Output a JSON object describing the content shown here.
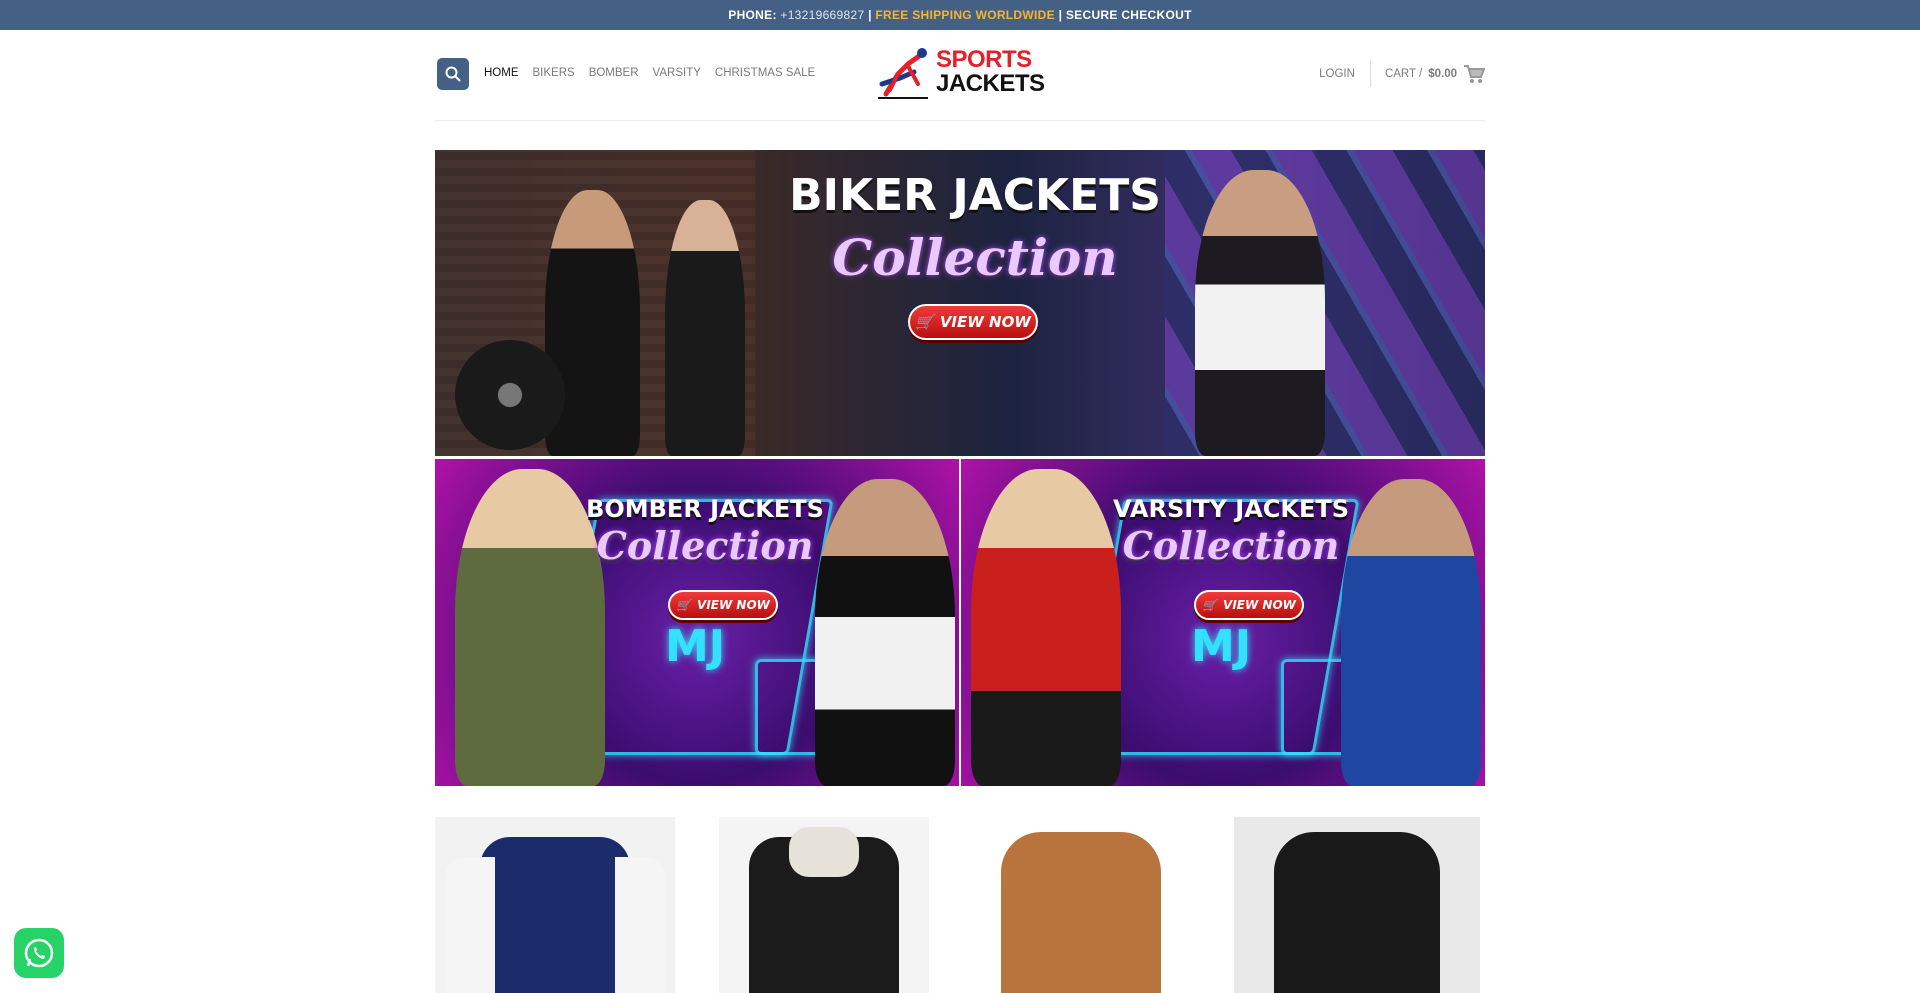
{
  "topbar": {
    "phone_label": "PHONE:",
    "phone_number": " +13219669827 ",
    "sep1": "| ",
    "shipping": "FREE SHIPPING WORLDWIDE",
    "sep2": " | ",
    "secure": "SECURE CHECKOUT"
  },
  "nav": {
    "items": [
      {
        "label": "HOME",
        "active": true
      },
      {
        "label": "BIKERS"
      },
      {
        "label": "BOMBER"
      },
      {
        "label": "VARSITY"
      },
      {
        "label": "CHRISTMAS SALE"
      }
    ]
  },
  "logo": {
    "line1": "SPORTS",
    "line2": "JACKETS"
  },
  "account": {
    "login": "LOGIN",
    "cart_label": "CART /",
    "cart_total": "$0.00"
  },
  "banners": {
    "main": {
      "title": "BIKER JACKETS",
      "script": "Collection",
      "button": "VIEW NOW"
    },
    "left": {
      "title": "BOMBER JACKETS",
      "script": "Collection",
      "button": "VIEW NOW",
      "emblem": "MJ"
    },
    "right": {
      "title": "VARSITY JACKETS",
      "script": "Collection",
      "button": "VIEW NOW",
      "emblem": "MJ"
    }
  },
  "colors": {
    "primary": "#446084",
    "accent": "#f6b531",
    "logo_red": "#e4202a",
    "whatsapp": "#25d366"
  },
  "icons": {
    "search": "search-icon",
    "cart": "cart-icon",
    "whatsapp": "whatsapp-icon"
  }
}
